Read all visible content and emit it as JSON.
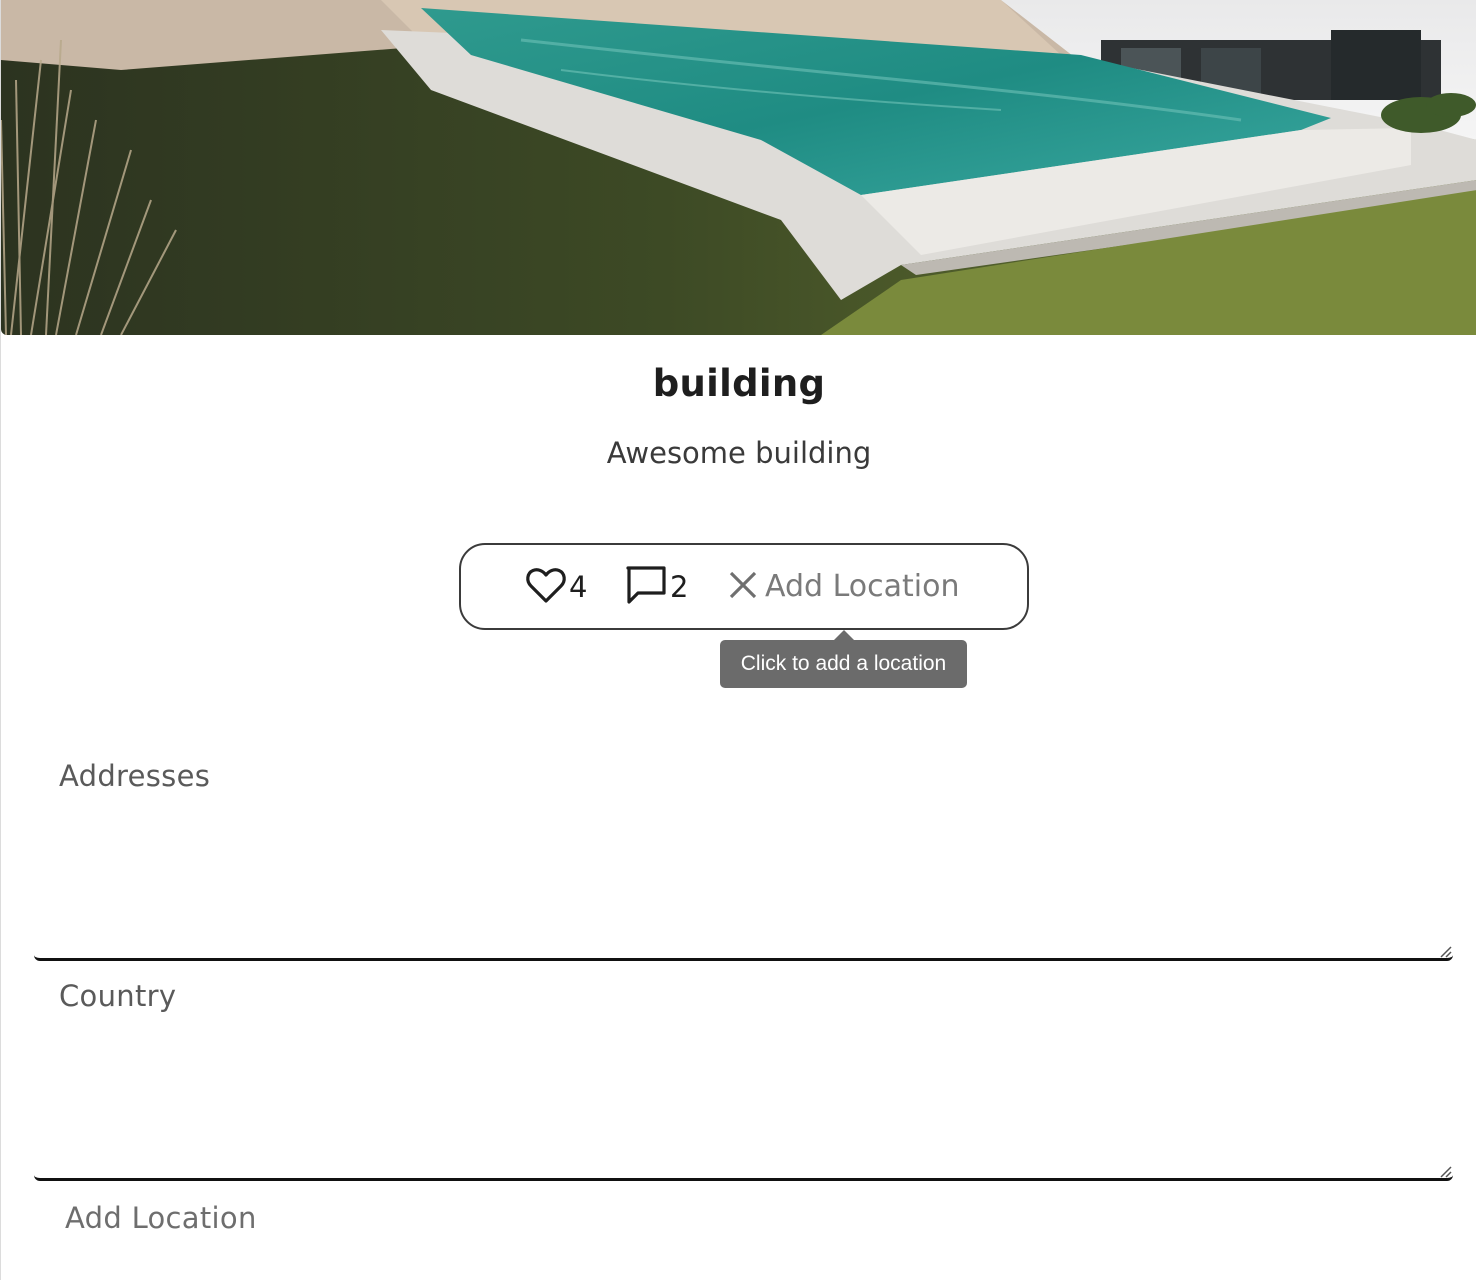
{
  "post": {
    "title": "building",
    "description": "Awesome building"
  },
  "actions": {
    "likes_count": "4",
    "comments_count": "2",
    "add_location_label": "Add Location"
  },
  "tooltip": {
    "text": "Click to add a location"
  },
  "form": {
    "addresses_label": "Addresses",
    "addresses_value": "",
    "country_label": "Country",
    "country_value": "",
    "add_location_link": "Add Location"
  },
  "colors": {
    "tooltip_bg": "#6b6b6b",
    "pill_border": "#3b3b3b",
    "muted_text": "#7a7a7a"
  },
  "icons": {
    "like": "heart-icon",
    "comment": "comment-icon",
    "close": "close-icon"
  }
}
